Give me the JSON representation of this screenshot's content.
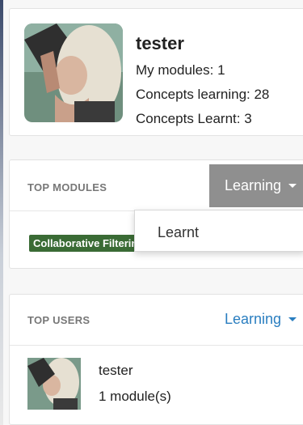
{
  "profile": {
    "name": "tester",
    "stats": [
      "My modules: 1",
      "Concepts learning: 28",
      "Concepts Learnt: 3"
    ]
  },
  "top_modules": {
    "title": "TOP MODULES",
    "filter_label": "Learning",
    "dropdown_option": "Learnt",
    "module_tag": "Collaborative Filtering",
    "tag_color": "#3a6b35"
  },
  "top_users": {
    "title": "TOP USERS",
    "filter_label": "Learning",
    "link_color": "#2a7ec0",
    "users": [
      {
        "name": "tester",
        "modules": "1 module(s)"
      }
    ]
  }
}
